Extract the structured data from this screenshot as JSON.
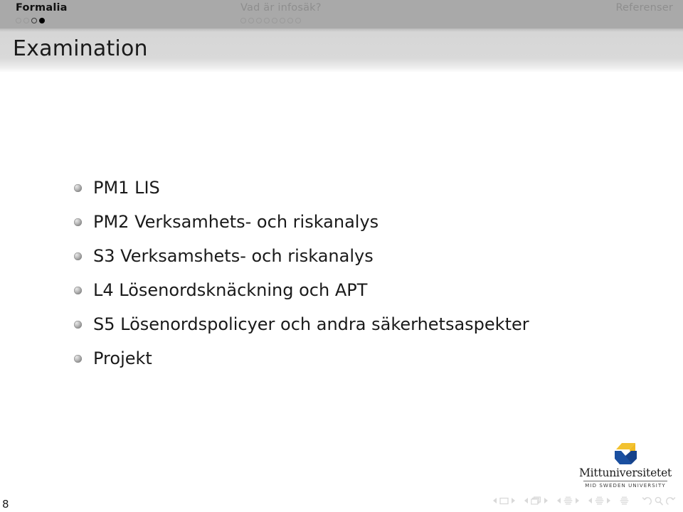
{
  "navbar": {
    "sections": [
      {
        "label": "Formalia",
        "state": "active",
        "dots": [
          "empty-dim",
          "empty-dim",
          "empty-dark",
          "filled"
        ]
      },
      {
        "label": "Vad är infosäk?",
        "state": "inactive",
        "dots": [
          "empty-dim",
          "empty-dim",
          "empty-dim",
          "empty-dim",
          "empty-dim",
          "empty-dim",
          "empty-dim",
          "empty-dim"
        ]
      },
      {
        "label": "Referenser",
        "state": "inactive",
        "dots": []
      }
    ]
  },
  "frame": {
    "title": "Examination",
    "items": [
      "PM1 LIS",
      "PM2 Verksamhets- och riskanalys",
      "S3 Verksamshets- och riskanalys",
      "L4 Lösenordsknäckning och APT",
      "S5 Lösenordspolicyer och andra säkerhetsaspekter",
      "Projekt"
    ]
  },
  "logo": {
    "name": "Mittuniversitetet",
    "subtitle": "MID SWEDEN UNIVERSITY",
    "mark_color_top": "#f2c230",
    "mark_color_bottom": "#1a4fa0"
  },
  "navigation_symbols": {
    "groups": [
      {
        "name": "frame",
        "icon": "frame-icon",
        "has_arrows": true
      },
      {
        "name": "subsection-slides",
        "icon": "slides-icon",
        "has_arrows": true
      },
      {
        "name": "subsection",
        "icon": "subsection-icon",
        "has_arrows": true
      },
      {
        "name": "section",
        "icon": "section-icon",
        "has_arrows": true
      },
      {
        "name": "presentation",
        "icon": "document-icon",
        "has_arrows": false
      }
    ],
    "tail": [
      {
        "name": "back",
        "icon": "back-icon"
      },
      {
        "name": "find",
        "icon": "search-icon"
      },
      {
        "name": "forward",
        "icon": "forward-icon"
      }
    ]
  },
  "footer": {
    "page_number": "8"
  },
  "colors": {
    "navbar_bg": "#a9a9a9",
    "titlebar_bg": "#d9d9d9",
    "content_bg": "#ffffff",
    "text": "#1a1a1a",
    "muted_text": "#8e8e8e",
    "navsym": "#d5d5d5"
  }
}
